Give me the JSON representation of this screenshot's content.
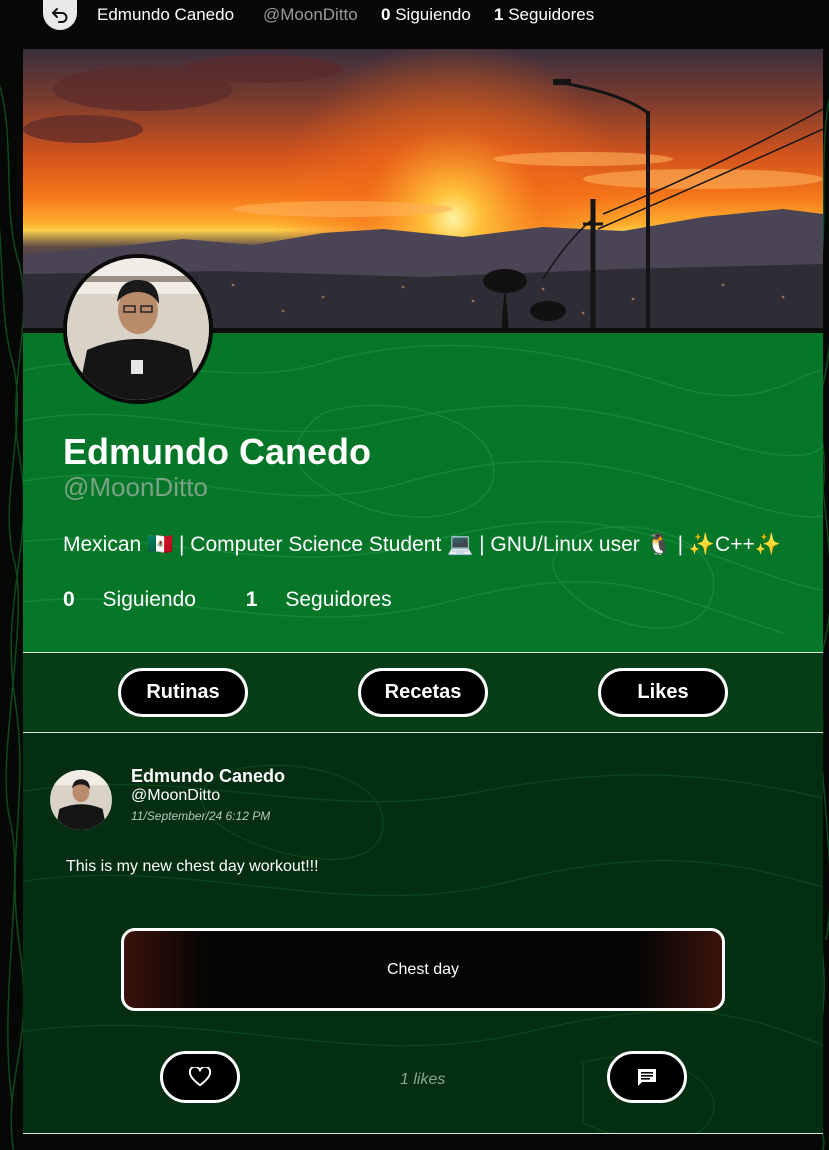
{
  "topbar": {
    "name": "Edmundo Canedo",
    "handle": "@MoonDitto",
    "following_count": "0",
    "following_label": "Siguiendo",
    "followers_count": "1",
    "followers_label": "Seguidores"
  },
  "profile": {
    "display_name": "Edmundo Canedo",
    "handle": "@MoonDitto",
    "bio": "Mexican 🇲🇽 | Computer Science Student 💻 | GNU/Linux user 🐧 | ✨C++✨",
    "following_count": "0",
    "following_label": "Siguiendo",
    "followers_count": "1",
    "followers_label": "Seguidores"
  },
  "tabs": [
    {
      "label": "Rutinas"
    },
    {
      "label": "Recetas"
    },
    {
      "label": "Likes"
    }
  ],
  "post": {
    "author_name": "Edmundo Canedo",
    "author_handle": "@MoonDitto",
    "timestamp": "11/September/24 6:12 PM",
    "text": "This is my new chest day workout!!!",
    "routine_title": "Chest day",
    "likes_text": "1 likes"
  },
  "icons": {
    "back": "undo-arrow-icon",
    "like": "heart-icon",
    "comment": "comment-icon"
  },
  "colors": {
    "panel_green": "#067629",
    "feed_green": "#042e11",
    "accent_white": "#ffffff"
  }
}
